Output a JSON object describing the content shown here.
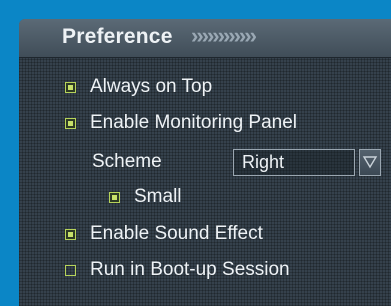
{
  "header": {
    "title": "Preference",
    "chevrons": "››››››››››››"
  },
  "options": {
    "always_on_top": {
      "label": "Always on Top",
      "checked": true
    },
    "enable_monitoring_panel": {
      "label": "Enable Monitoring Panel",
      "checked": true
    },
    "scheme": {
      "label": "Scheme",
      "value": "Right"
    },
    "small": {
      "label": "Small",
      "checked": true
    },
    "enable_sound_effect": {
      "label": "Enable Sound Effect",
      "checked": true
    },
    "run_in_boot_up_session": {
      "label": "Run in Boot-up Session",
      "checked": false
    }
  },
  "colors": {
    "background": "#0b86c6",
    "panel": "#35414c",
    "checkbox_accent": "#c7e06a",
    "text": "#eef2f5"
  }
}
